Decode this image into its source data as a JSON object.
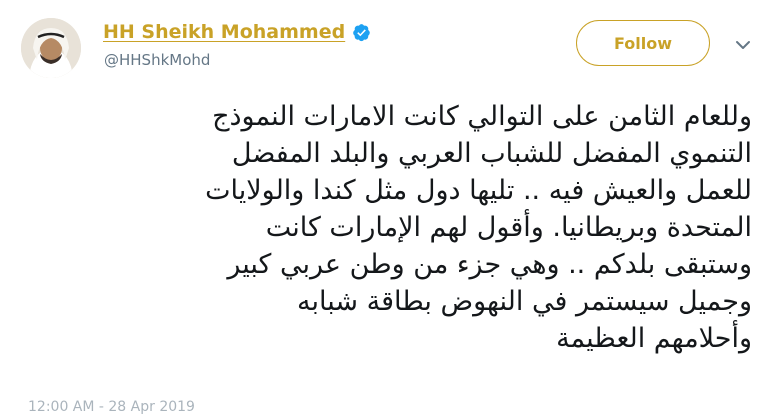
{
  "tweet": {
    "display_name": "HH Sheikh Mohammed",
    "handle": "@HHShkMohd",
    "verified": true,
    "follow_label": "Follow",
    "text": "وللعام الثامن على التوالي كانت الامارات النموذج\nالتنموي المفضل للشباب العربي والبلد المفضل\nللعمل والعيش فيه .. تليها دول مثل كندا والولايات\nالمتحدة وبريطانيا. وأقول لهم الإمارات كانت\nوستبقى بلدكم .. وهي جزء من وطن عربي كبير\nوجميل سيستمر في النهوض بطاقة شبابه\nوأحلامهم العظيمة",
    "timestamp": "12:00 AM - 28 Apr 2019"
  },
  "colors": {
    "accent": "#c9a227",
    "verified_badge": "#1da1f2",
    "secondary_text": "#657786",
    "body_text": "#14171a"
  },
  "icons": {
    "verified": "verified-badge-icon",
    "caret": "chevron-down-icon"
  }
}
